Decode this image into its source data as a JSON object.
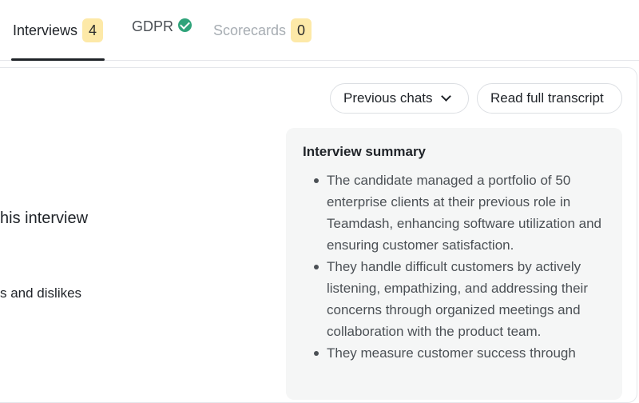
{
  "tabs": {
    "interviews": {
      "label": "Interviews",
      "count": "4"
    },
    "gdpr": {
      "label": "GDPR",
      "status_icon": "check-circle-icon",
      "status_color": "#2fa37a"
    },
    "scorecards": {
      "label": "Scorecards",
      "count": "0"
    }
  },
  "left": {
    "line1": "his interview",
    "line2": "s and dislikes"
  },
  "toolbar": {
    "previous_chats": "Previous chats",
    "read_full_transcript": "Read full transcript"
  },
  "summary": {
    "title": "Interview summary",
    "items": [
      "The candidate managed a portfolio of 50 enterprise clients at their previous role in Teamdash, enhancing software utilization and ensuring customer satisfaction.",
      "They handle difficult customers by actively listening, empathizing, and addressing their concerns through organized meetings and collaboration with the product team.",
      "They measure customer success through"
    ]
  },
  "colors": {
    "badge": "#fde9a8",
    "summary_bg": "#f5f6f6",
    "active_tab": "#1f2328",
    "inactive_tab": "#a7adb3"
  }
}
